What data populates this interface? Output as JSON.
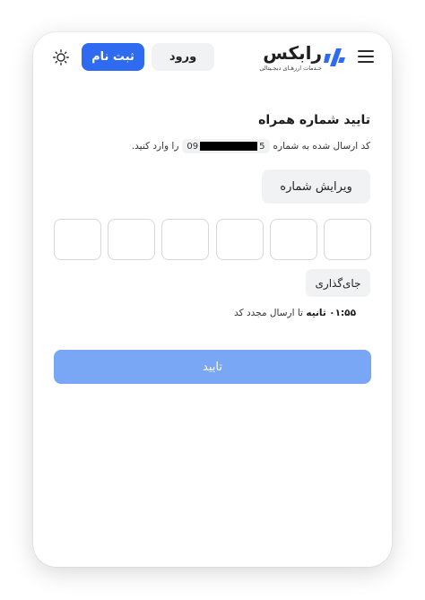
{
  "header": {
    "logo_name": "رابکس",
    "logo_tagline": "خـدمات ارزهـای دیجـیتالی",
    "login_label": "ورود",
    "signup_label": "ثبت نام",
    "menu_icon": "hamburger-menu-icon",
    "theme_icon": "sun-icon"
  },
  "verify": {
    "title": "تایید شماره همراه",
    "sent_prefix": "کد ارسال شده به شماره",
    "phone_start": "09",
    "phone_end": "5",
    "sent_suffix": "را وارد کنید.",
    "edit_label": "ویرایش شماره",
    "otp_length": 6,
    "paste_label": "جای‌گذاری",
    "timer_value": "۰۱:۵۵",
    "timer_unit": "ثانیه",
    "timer_suffix": "تا ارسال مجدد کد",
    "confirm_label": "تایید"
  },
  "colors": {
    "primary": "#2f6bf0",
    "primary_disabled": "#7aa7f5",
    "neutral_button": "#f1f2f4",
    "logo_accent": "#2f6bf0"
  }
}
